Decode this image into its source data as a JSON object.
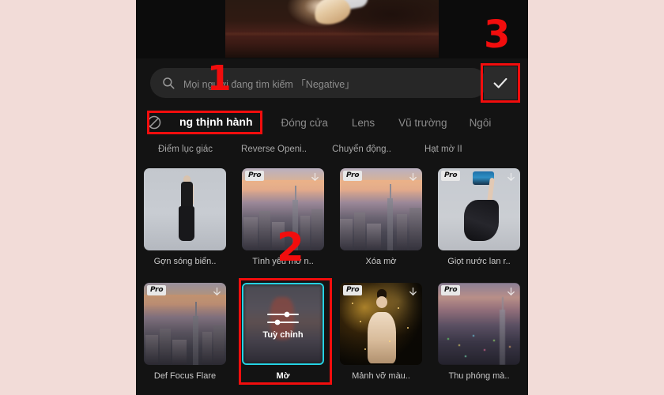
{
  "app": {
    "background_color": "#f2dcd8",
    "phone_background": "#131313",
    "accent_selected": "#24d2e3",
    "annotation_color": "#f20d0d"
  },
  "preview": {
    "name": "video-preview"
  },
  "search": {
    "placeholder": "Mọi người đang tìm kiếm 「Negative」",
    "value": "",
    "icon": "search-icon",
    "confirm_icon": "check-icon"
  },
  "tabs": {
    "block_icon": "no-entry-icon",
    "items": [
      {
        "label": "ng thịnh hành",
        "active": true
      },
      {
        "label": "Đóng cửa",
        "active": false
      },
      {
        "label": "Lens",
        "active": false
      },
      {
        "label": "Vũ trường",
        "active": false
      },
      {
        "label": "Ngôi",
        "active": false
      }
    ]
  },
  "subtabs": {
    "items": [
      {
        "label": "Điểm lục giác"
      },
      {
        "label": "Reverse Openi.."
      },
      {
        "label": "Chuyển động.."
      },
      {
        "label": "Hạt mờ II"
      }
    ]
  },
  "grid": {
    "pro_badge_label": "Pro",
    "download_icon": "download-arrow-icon",
    "rows": [
      [
        {
          "label": "Gợn sóng biển..",
          "pro": false,
          "download": false,
          "art": "model",
          "selected": false
        },
        {
          "label": "Tình yêu mờ n..",
          "pro": true,
          "download": true,
          "art": "city",
          "selected": false
        },
        {
          "label": "Xóa mờ",
          "pro": true,
          "download": true,
          "art": "city",
          "selected": false
        },
        {
          "label": "Giọt nước lan r..",
          "pro": true,
          "download": true,
          "art": "dress",
          "selected": false
        }
      ],
      [
        {
          "label": "Def Focus Flare",
          "pro": true,
          "download": true,
          "art": "city",
          "selected": false
        },
        {
          "label": "Mờ",
          "pro": false,
          "download": false,
          "art": "custom",
          "selected": true,
          "tile_text": "Tuỳ chỉnh",
          "tile_icon": "sliders-icon"
        },
        {
          "label": "Mảnh vỡ màu..",
          "pro": true,
          "download": true,
          "art": "gold",
          "selected": false
        },
        {
          "label": "Thu phóng mà..",
          "pro": true,
          "download": true,
          "art": "citynight",
          "selected": false
        }
      ]
    ]
  },
  "annotations": {
    "steps": [
      {
        "label": "1"
      },
      {
        "label": "2"
      },
      {
        "label": "3"
      }
    ]
  }
}
